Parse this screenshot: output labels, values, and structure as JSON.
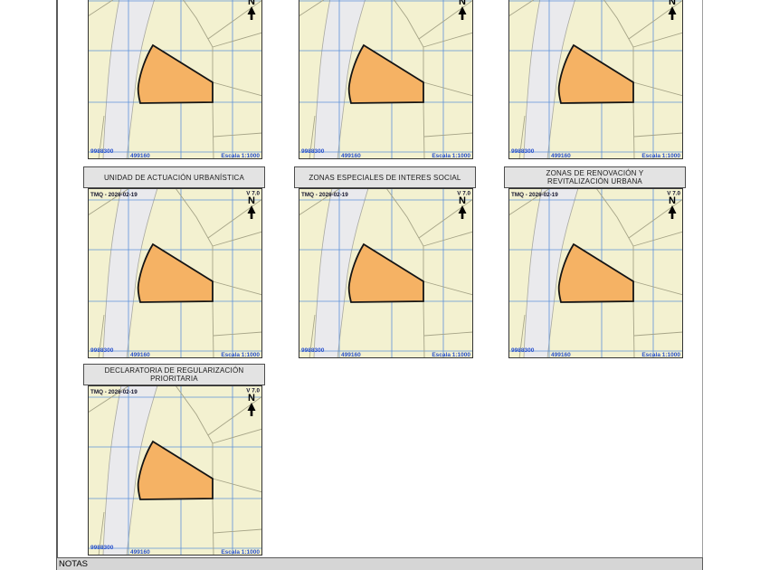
{
  "document": {
    "notes_label": "NOTAS"
  },
  "map_common": {
    "stamp": "TMQ - 2026-02-19",
    "version": "V 7.0",
    "north_label": "N",
    "grid_northing": "9988300",
    "grid_easting": "499160",
    "scale": "Escala 1:1000"
  },
  "maps": [
    {
      "title": ""
    },
    {
      "title": ""
    },
    {
      "title": ""
    },
    {
      "title": "UNIDAD DE ACTUACIÓN URBANÍSTICA"
    },
    {
      "title": "ZONAS ESPECIALES DE INTERES SOCIAL"
    },
    {
      "title": "ZONAS DE RENOVACIÓN Y REVITALIZACIÓN URBANA"
    },
    {
      "title": "DECLARATORIA DE REGULARIZACIÓN PRIORITARIA"
    }
  ],
  "colors": {
    "map_background": "#f3f1d0",
    "grid_blue": "#5e92d9",
    "road_fill": "#eaeaed",
    "road_edge": "#a8a8a0",
    "parcel_line": "#a6a487",
    "highlight_parcel_fill": "#f5b264",
    "highlight_parcel_stroke": "#141414",
    "coordinate_text_blue": "#2750cc",
    "panel_title_background": "#e3e3e3",
    "notes_bar_background": "#d6d6d6"
  }
}
